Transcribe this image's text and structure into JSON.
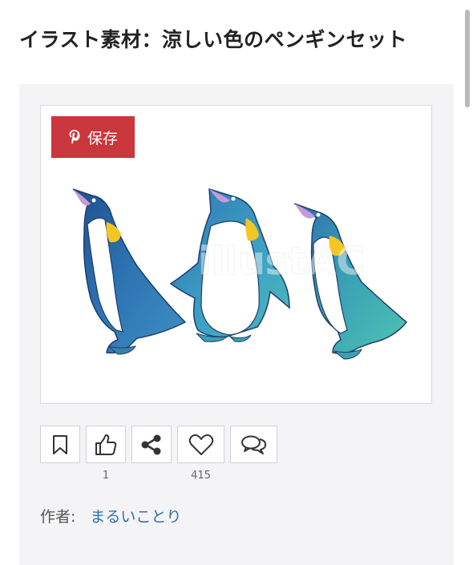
{
  "page": {
    "title": "イラスト素材：涼しい色のペンギンセット"
  },
  "image_card": {
    "save_button_label": "保存",
    "watermark_text": "illustAC"
  },
  "actions": [
    {
      "name": "bookmark",
      "icon": "bookmark-icon",
      "count": ""
    },
    {
      "name": "like",
      "icon": "thumbs-up-icon",
      "count": "1"
    },
    {
      "name": "share",
      "icon": "share-icon",
      "count": ""
    },
    {
      "name": "favorite",
      "icon": "heart-icon",
      "count": "415"
    },
    {
      "name": "comment",
      "icon": "comment-icon",
      "count": ""
    }
  ],
  "author": {
    "label": "作者:",
    "name": "まるいことり"
  },
  "colors": {
    "save_button": "#c9363b",
    "link": "#2d6fa8",
    "panel_bg": "#f4f4f6"
  }
}
